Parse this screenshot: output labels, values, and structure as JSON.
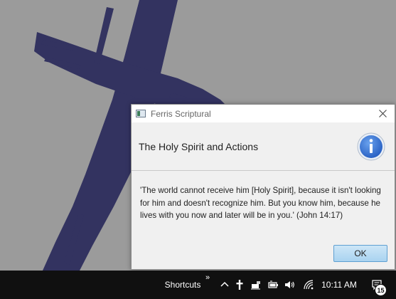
{
  "window": {
    "title": "Ferris Scriptural",
    "header": "The Holy Spirit and Actions",
    "message": "'The world cannot receive him [Holy Spirit], because it isn't looking for him and doesn't recognize him. But you know him, because he lives with you now and later will be in you.' (John 14:17)",
    "ok_label": "OK"
  },
  "taskbar": {
    "toolbar_label": "Shortcuts",
    "overflow_glyph": "»",
    "time": "10:11 AM",
    "notification_count": "15"
  },
  "colors": {
    "cross": "#333360",
    "desktop": "#9b9b9b",
    "info_icon": "#2f6fd0",
    "taskbar": "#101010"
  }
}
